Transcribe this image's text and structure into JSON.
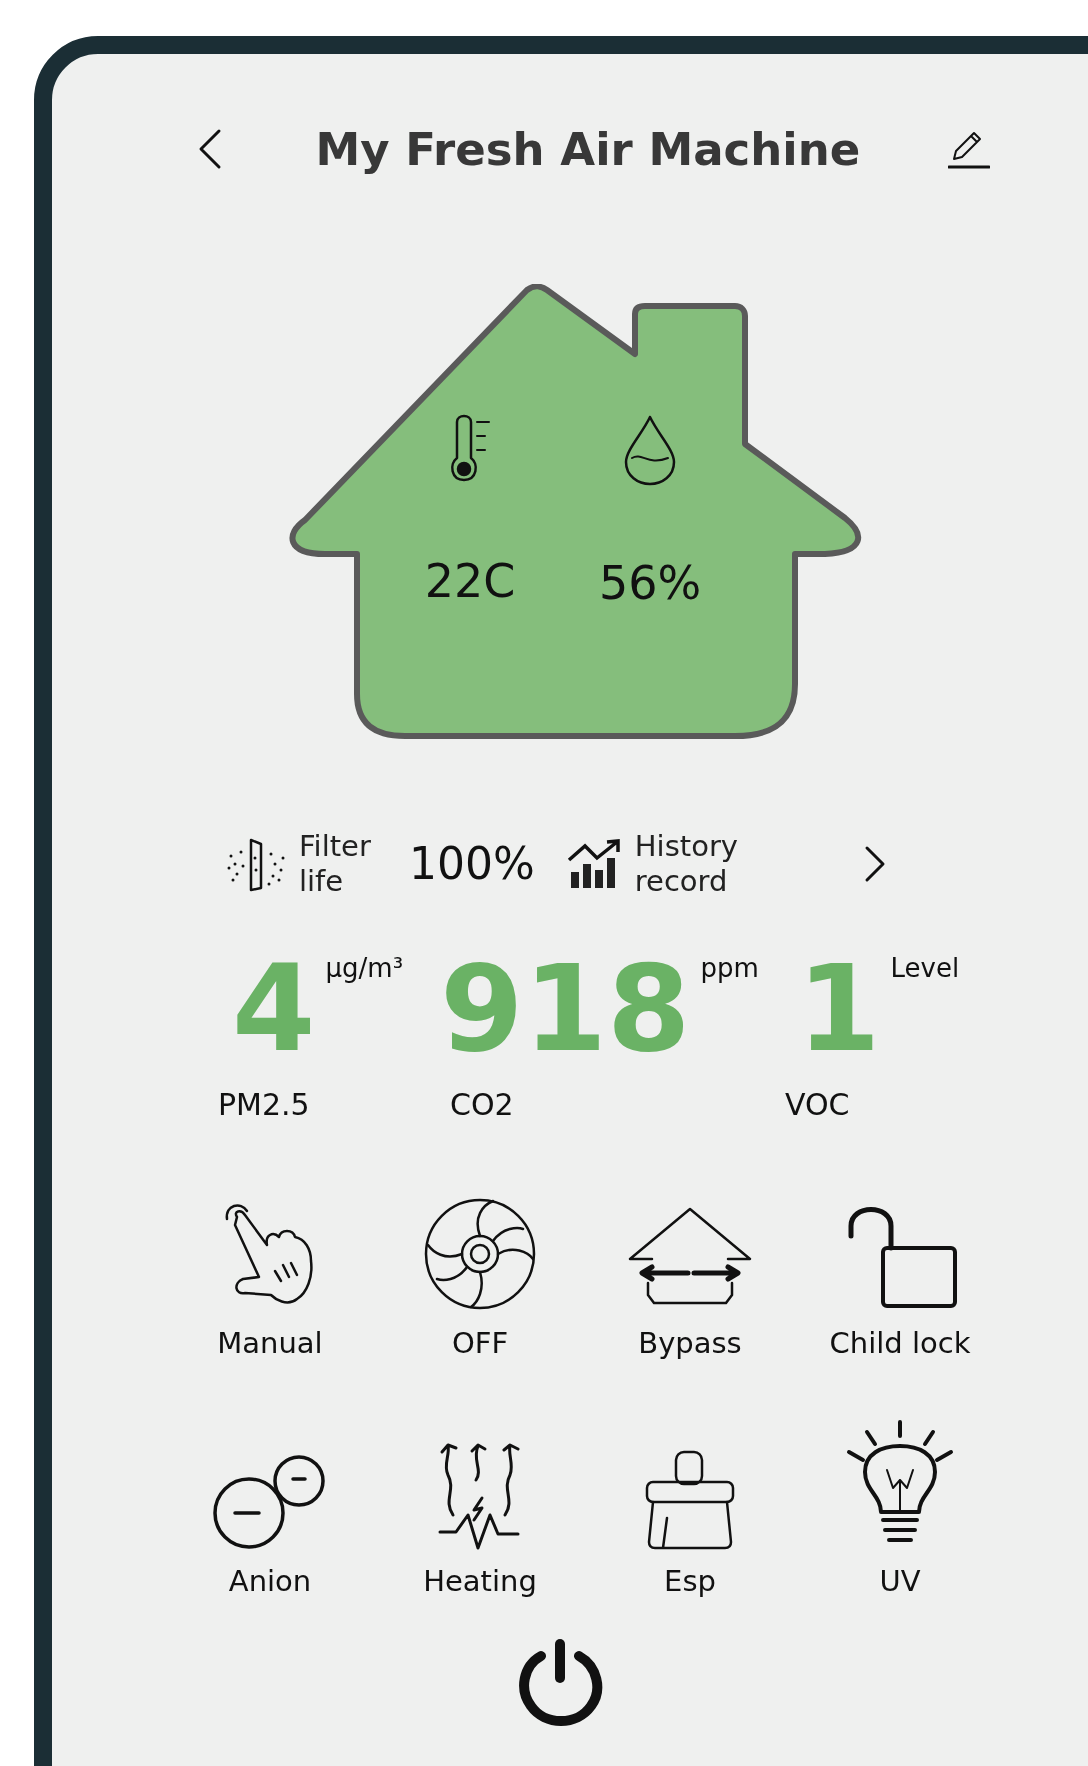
{
  "header": {
    "title": "My Fresh Air Machine"
  },
  "climate": [
    {
      "kind": "temperature",
      "value": "22C"
    },
    {
      "kind": "humidity",
      "value": "56%"
    }
  ],
  "filter": {
    "label": "Filter life",
    "value": "100%"
  },
  "history": {
    "label": "History record"
  },
  "metrics": [
    {
      "value": "4",
      "unit": "µg/m³",
      "label": "PM2.5"
    },
    {
      "value": "918",
      "unit": "ppm",
      "label": "CO2"
    },
    {
      "value": "1",
      "unit": "Level",
      "label": "VOC"
    }
  ],
  "controls": [
    {
      "kind": "manual",
      "label": "Manual"
    },
    {
      "kind": "fan",
      "label": "OFF"
    },
    {
      "kind": "bypass",
      "label": "Bypass"
    },
    {
      "kind": "lock",
      "label": "Child lock"
    },
    {
      "kind": "anion",
      "label": "Anion"
    },
    {
      "kind": "heating",
      "label": "Heating"
    },
    {
      "kind": "esp",
      "label": "Esp"
    },
    {
      "kind": "uv",
      "label": "UV"
    }
  ]
}
